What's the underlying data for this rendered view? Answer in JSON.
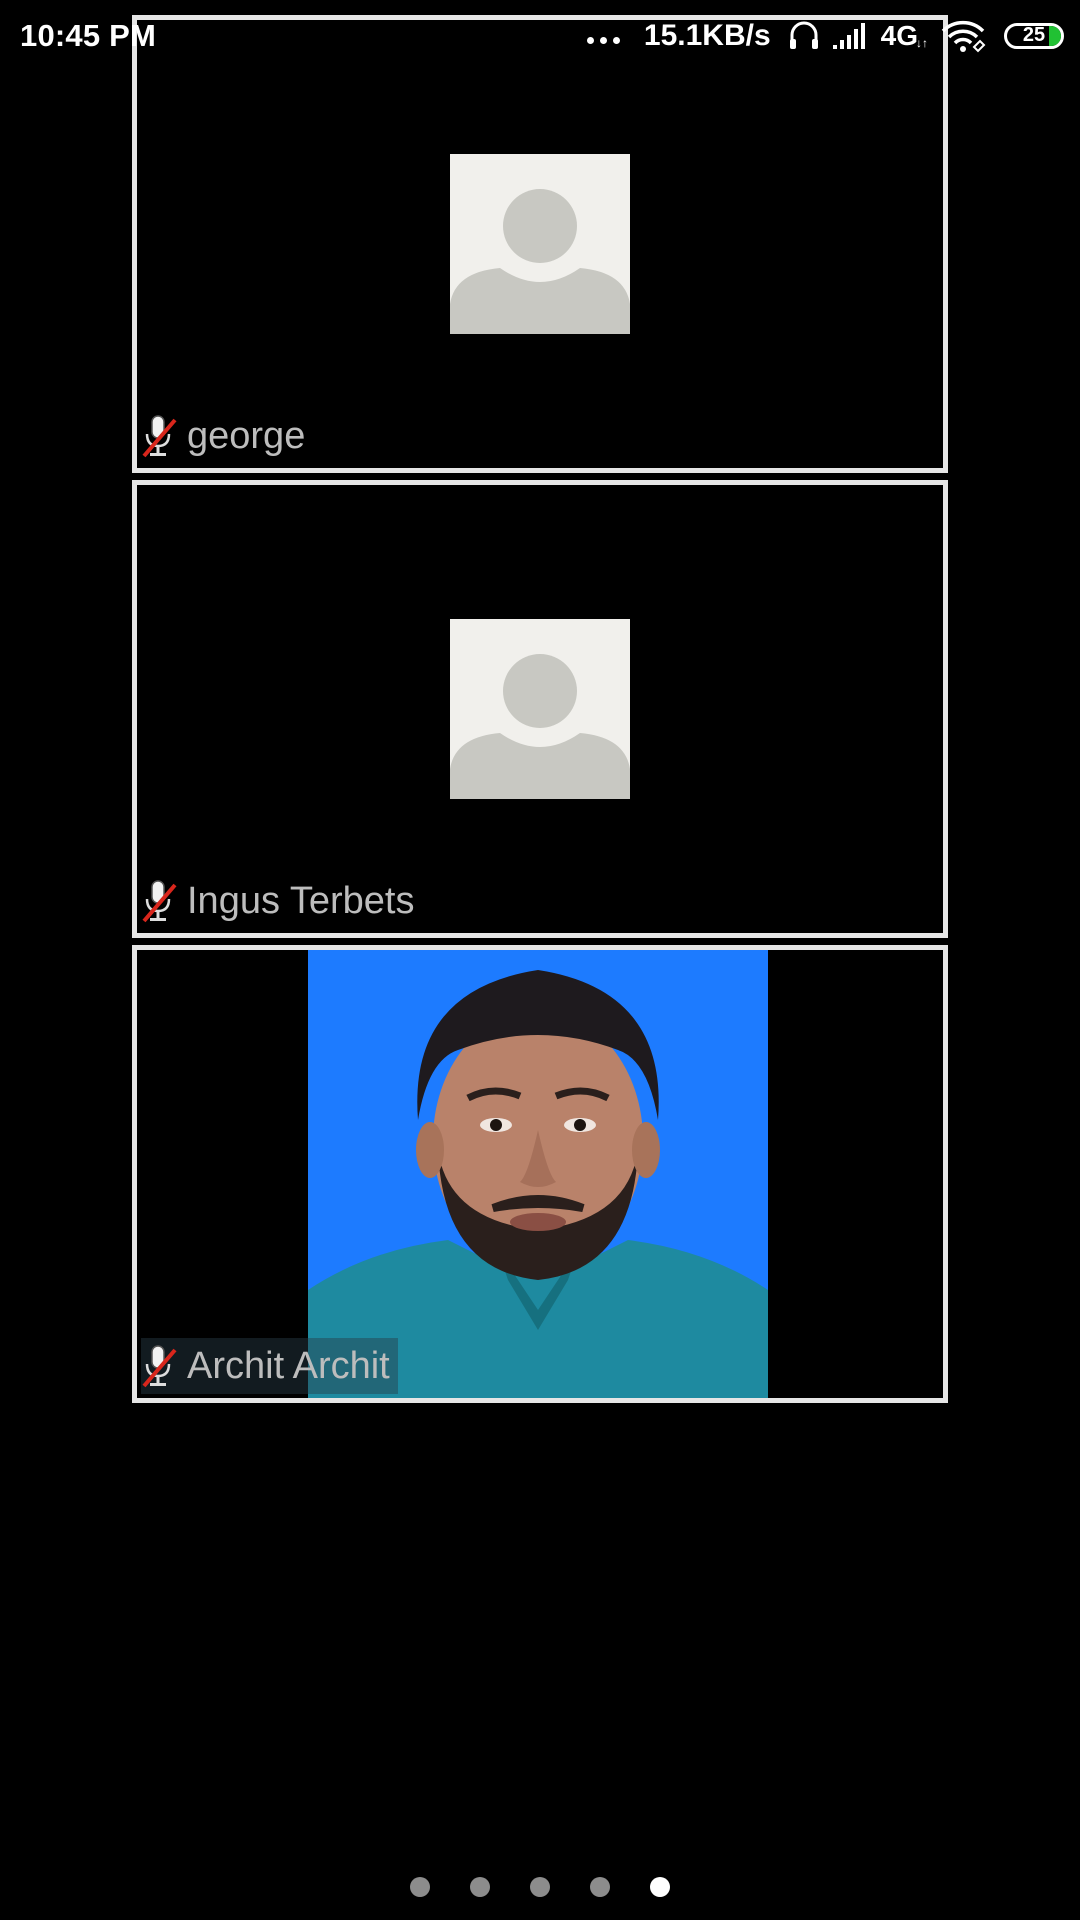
{
  "status_bar": {
    "time": "10:45 PM",
    "net_speed": "15.1KB/s",
    "network_type": "4G",
    "battery_level": "25",
    "icons": [
      "more-dots-icon",
      "headset-icon",
      "signal-icon",
      "wifi-icon",
      "battery-icon"
    ]
  },
  "participants": [
    {
      "name": "george",
      "muted": true,
      "media": "avatar-placeholder"
    },
    {
      "name": "Ingus Terbets",
      "muted": true,
      "media": "avatar-placeholder"
    },
    {
      "name": "Archit Archit",
      "muted": true,
      "media": "video"
    }
  ],
  "pager": {
    "total_pages": 5,
    "active_page": 5
  },
  "colors": {
    "tile_border": "#e6e6e6",
    "avatar_bg": "#f1f0ec",
    "avatar_fg": "#c8c8c2",
    "video_bg": "#1d7bff",
    "mute_slash": "#d9261c",
    "battery_fill": "#21c133"
  }
}
